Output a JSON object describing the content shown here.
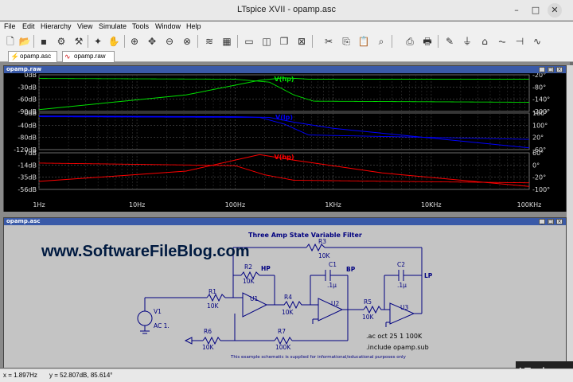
{
  "window": {
    "title": "LTspice XVII - opamp.asc"
  },
  "menu": [
    "File",
    "Edit",
    "Hierarchy",
    "View",
    "Simulate",
    "Tools",
    "Window",
    "Help"
  ],
  "tabs": [
    {
      "label": "opamp.asc",
      "icon": "schematic-icon"
    },
    {
      "label": "opamp.raw",
      "icon": "waveform-icon"
    }
  ],
  "plot_window": {
    "title": "opamp.raw",
    "panes": [
      {
        "trace": "V(hp)",
        "color": "#00e000",
        "left_ticks": [
          "0dB",
          "-30dB",
          "-60dB",
          "-90dB"
        ],
        "right_ticks": [
          "-20°",
          "-80°",
          "-140°",
          "-200°"
        ]
      },
      {
        "trace": "V(lp)",
        "color": "#0000ff",
        "left_ticks": [
          "0dB",
          "-40dB",
          "-80dB",
          "-120dB"
        ],
        "right_ticks": [
          "180°",
          "100°",
          "20°",
          "-60°"
        ]
      },
      {
        "trace": "V(bp)",
        "color": "#ff0000",
        "left_ticks": [
          "7dB",
          "-14dB",
          "-35dB",
          "-56dB"
        ],
        "right_ticks": [
          "60°",
          "0°",
          "-20°",
          "-100°"
        ]
      }
    ],
    "x_ticks": [
      "1Hz",
      "10Hz",
      "100Hz",
      "1KHz",
      "10KHz",
      "100KHz"
    ]
  },
  "schematic_window": {
    "title": "opamp.asc",
    "heading": "Three Amp State Variable Filter",
    "labels": {
      "r3": "R3",
      "r3v": "10K",
      "r2": "R2",
      "r2v": "10K",
      "hp": "HP",
      "c1": "C1",
      "c1v": ".1µ",
      "bp": "BP",
      "c2": "C2",
      "c2v": ".1µ",
      "lp": "LP",
      "v1": "V1",
      "v1v": "AC 1.",
      "r1": "R1",
      "r1v": "10K",
      "u1": "U1",
      "u2": "U2",
      "u3": "U3",
      "r4": "R4",
      "r4v": "10K",
      "r5": "R5",
      "r5v": "10K",
      "r6": "R6",
      "r6v": "10K",
      "r7": "R7",
      "r7v": "100K",
      "directive1": ".ac oct 25 1 100K",
      "directive2": ".include opamp.sub",
      "footnote": "This example schematic is supplied for informational/educational purposes only"
    }
  },
  "watermark": "www.SoftwareFileBlog.com",
  "status": {
    "x": "x = 1.897Hz",
    "y": "y = 52.807dB, 85.614°"
  },
  "background_text": "LTspice XVI"
}
